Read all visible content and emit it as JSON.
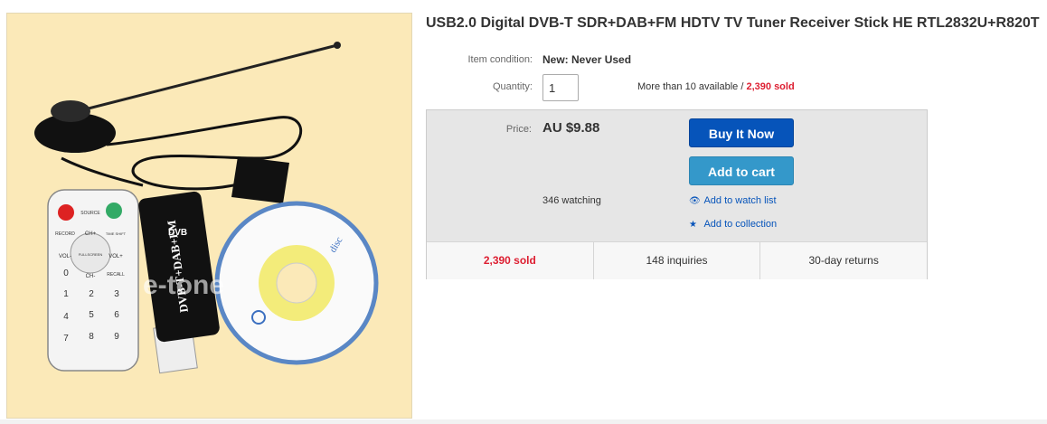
{
  "listing": {
    "title": "USB2.0 Digital DVB-T SDR+DAB+FM HDTV TV Tuner Receiver Stick HE RTL2832U+R820T",
    "image": {
      "stick_label": "DVB-T+DAB+FM",
      "dvb_logo": "DVB",
      "disc_label": "disc",
      "watermark": "e-tone",
      "remote_labels": [
        "RECORD",
        "SOURCE",
        "TIME SHIFT",
        "CH+",
        "VOL-",
        "FULLSCREEN",
        "VOL+",
        "0",
        "CH-",
        "RECALL",
        "1",
        "2",
        "3",
        "4",
        "5",
        "6",
        "7",
        "8",
        "9"
      ]
    }
  },
  "condition": {
    "label": "Item condition:",
    "value": "New: Never Used"
  },
  "quantity": {
    "label": "Quantity:",
    "value": "1",
    "available": "More than 10 available /",
    "sold": "2,390 sold"
  },
  "price": {
    "label": "Price:",
    "value": "AU $9.88"
  },
  "buttons": {
    "buy_now": "Buy It Now",
    "add_to_cart": "Add to cart"
  },
  "watching": "346 watching",
  "links": {
    "watch_list": "Add to watch list",
    "collection": "Add to collection"
  },
  "stats": {
    "sold": "2,390 sold",
    "inquiries": "148 inquiries",
    "returns": "30-day returns"
  },
  "colors": {
    "brand_blue": "#0654ba",
    "cart_blue": "#3498ca",
    "sold_red": "#dd1e31",
    "image_bg": "#fbe9b8"
  },
  "icons": {
    "watch": "eye-icon",
    "collection": "star-icon"
  }
}
